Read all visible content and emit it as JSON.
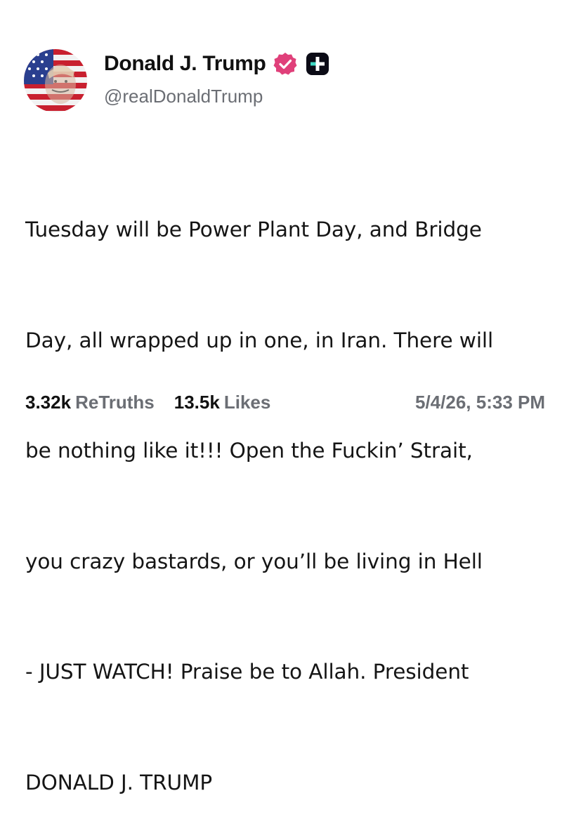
{
  "profile": {
    "display_name": "Donald J. Trump",
    "handle": "@realDonaldTrump",
    "verified_icon": "verified-badge-icon",
    "verified_color": "#e0407a",
    "plus_icon": "truth-plus-badge-icon"
  },
  "post": {
    "lines": [
      "Tuesday will be Power Plant Day, and Bridge",
      "Day, all wrapped up in one, in Iran. There will",
      "be nothing like it!!! Open the Fuckin’ Strait,",
      "you crazy bastards, or you’ll be living in Hell",
      "- JUST WATCH! Praise be to Allah. President",
      "DONALD J. TRUMP"
    ]
  },
  "stats": {
    "retruths_count": "3.32k",
    "retruths_label": "ReTruths",
    "likes_count": "13.5k",
    "likes_label": "Likes"
  },
  "timestamp": "5/4/26, 5:33 PM"
}
